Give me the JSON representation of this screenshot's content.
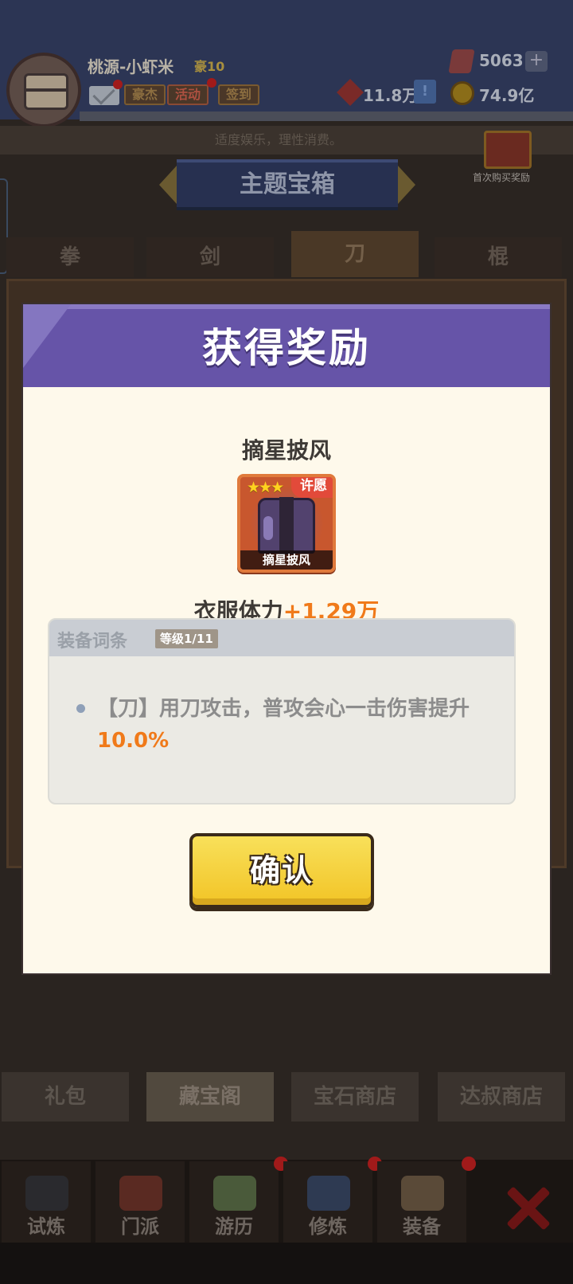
{
  "player": {
    "name": "桃源-小虾米",
    "vip_label": "豪10",
    "tags": [
      "豪杰",
      "活动",
      "签到"
    ]
  },
  "resources": {
    "gems": "5063",
    "gems_add": "+",
    "power": "11.8万",
    "power_info": "!",
    "coins": "74.9亿"
  },
  "header": {
    "slogan": "适度娱乐，理性消费。",
    "first_buy_label": "首次购买奖励",
    "banner_title": "主题宝箱"
  },
  "weapon_tabs": [
    "拳",
    "剑",
    "刀",
    "棍"
  ],
  "weapon_tabs_selected": "刀",
  "shop_tabs": [
    "礼包",
    "藏宝阁",
    "宝石商店",
    "达叔商店"
  ],
  "shop_tabs_selected": "藏宝阁",
  "bottom_nav": [
    "试炼",
    "门派",
    "游历",
    "修炼",
    "装备"
  ],
  "icons": {
    "mail": "mail-icon",
    "gem": "gem-icon",
    "coin": "coin-icon",
    "power": "power-icon",
    "close": "close-icon"
  },
  "modal": {
    "title": "获得奖励",
    "item_name": "摘星披风",
    "item_card_label": "摘星披风",
    "item_badge": "许愿",
    "item_stars": "★★★",
    "stat_label": "衣服体力",
    "stat_value": "+1.29万",
    "affix_title": "装备词条",
    "affix_level": "等级1/11",
    "affix_text_prefix": "【刀】用刀攻击，普攻会心一击伤害提升",
    "affix_value": "10.0%",
    "confirm_label": "确认"
  },
  "colors": {
    "modal_header": "#6654a8",
    "highlight": "#f07a1a",
    "confirm_button": "#f2c426"
  }
}
